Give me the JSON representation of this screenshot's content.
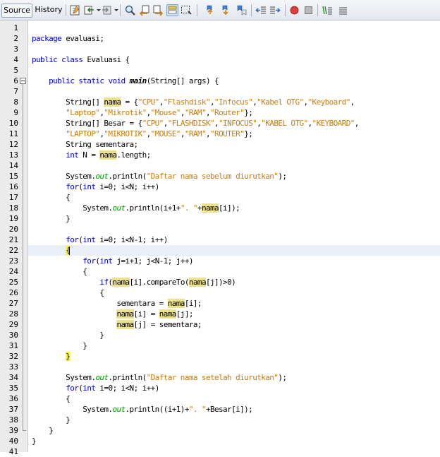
{
  "tabs": {
    "source": "Source",
    "history": "History"
  },
  "toolbar_icons": [
    "last-edit-icon",
    "back-icon",
    "forward-icon",
    "find-icon",
    "find-previous-icon",
    "find-next-icon",
    "toggle-highlight-icon",
    "find-selection-icon",
    "previous-bookmark-icon",
    "next-bookmark-icon",
    "toggle-bookmark-icon",
    "shift-left-icon",
    "shift-right-icon",
    "start-macro-icon",
    "stop-macro-icon",
    "comment-icon",
    "uncomment-icon"
  ],
  "colors": {
    "keyword": "#0000e6",
    "string": "#ce7b00",
    "field": "#009900",
    "highlight": "#ede18b",
    "brace_match": "#ffff00",
    "current_line": "#e9eff8"
  },
  "code": {
    "line_numbers": [
      "1",
      "2",
      "3",
      "4",
      "5",
      "6",
      "7",
      "8",
      "9",
      "10",
      "11",
      "12",
      "13",
      "14",
      "15",
      "16",
      "17",
      "18",
      "19",
      "20",
      "21",
      "22",
      "23",
      "24",
      "25",
      "26",
      "27",
      "28",
      "29",
      "30",
      "31",
      "32",
      "33",
      "34",
      "35",
      "36",
      "37",
      "38",
      "39",
      "40",
      "41"
    ],
    "lines": [
      [],
      [
        {
          "t": "package",
          "c": "kw"
        },
        {
          "t": " evaluasi;"
        }
      ],
      [],
      [
        {
          "t": "public",
          "c": "kw"
        },
        {
          "t": " "
        },
        {
          "t": "class",
          "c": "kw"
        },
        {
          "t": " Evaluasi {"
        }
      ],
      [],
      [
        {
          "t": "    "
        },
        {
          "t": "public",
          "c": "kw"
        },
        {
          "t": " "
        },
        {
          "t": "static",
          "c": "kw"
        },
        {
          "t": " "
        },
        {
          "t": "void",
          "c": "kw"
        },
        {
          "t": " "
        },
        {
          "t": "main",
          "c": "mth"
        },
        {
          "t": "(String[] args) {"
        }
      ],
      [],
      [
        {
          "t": "        String[] "
        },
        {
          "t": "nama",
          "c": "hl"
        },
        {
          "t": " = {"
        },
        {
          "t": "\"CPU\"",
          "c": "str"
        },
        {
          "t": ","
        },
        {
          "t": "\"Flashdisk\"",
          "c": "str"
        },
        {
          "t": ","
        },
        {
          "t": "\"Infocus\"",
          "c": "str"
        },
        {
          "t": ","
        },
        {
          "t": "\"Kabel OTG\"",
          "c": "str"
        },
        {
          "t": ","
        },
        {
          "t": "\"Keyboard\"",
          "c": "str"
        },
        {
          "t": ","
        }
      ],
      [
        {
          "t": "        "
        },
        {
          "t": "\"Laptop\"",
          "c": "str"
        },
        {
          "t": ","
        },
        {
          "t": "\"Mikrotik\"",
          "c": "str"
        },
        {
          "t": ","
        },
        {
          "t": "\"Mouse\"",
          "c": "str"
        },
        {
          "t": ","
        },
        {
          "t": "\"RAM\"",
          "c": "str"
        },
        {
          "t": ","
        },
        {
          "t": "\"Router\"",
          "c": "str"
        },
        {
          "t": "};"
        }
      ],
      [
        {
          "t": "        String[] Besar = {"
        },
        {
          "t": "\"CPU\"",
          "c": "str"
        },
        {
          "t": ","
        },
        {
          "t": "\"FLASHDISK\"",
          "c": "str"
        },
        {
          "t": ","
        },
        {
          "t": "\"INFOCUS\"",
          "c": "str"
        },
        {
          "t": ","
        },
        {
          "t": "\"KABEL OTG\"",
          "c": "str"
        },
        {
          "t": ","
        },
        {
          "t": "\"KEYBOARD\"",
          "c": "str"
        },
        {
          "t": ","
        }
      ],
      [
        {
          "t": "        "
        },
        {
          "t": "\"LAPTOP\"",
          "c": "str"
        },
        {
          "t": ","
        },
        {
          "t": "\"MIKROTIK\"",
          "c": "str"
        },
        {
          "t": ","
        },
        {
          "t": "\"MOUSE\"",
          "c": "str"
        },
        {
          "t": ","
        },
        {
          "t": "\"RAM\"",
          "c": "str"
        },
        {
          "t": ","
        },
        {
          "t": "\"ROUTER\"",
          "c": "str"
        },
        {
          "t": "};"
        }
      ],
      [
        {
          "t": "        String sementara;"
        }
      ],
      [
        {
          "t": "        "
        },
        {
          "t": "int",
          "c": "kw"
        },
        {
          "t": " N = "
        },
        {
          "t": "nama",
          "c": "hl"
        },
        {
          "t": ".length;"
        }
      ],
      [],
      [
        {
          "t": "        System."
        },
        {
          "t": "out",
          "c": "fld"
        },
        {
          "t": ".println("
        },
        {
          "t": "\"Daftar nama sebelum diurutkan\"",
          "c": "str"
        },
        {
          "t": ");"
        }
      ],
      [
        {
          "t": "        "
        },
        {
          "t": "for",
          "c": "kw"
        },
        {
          "t": "("
        },
        {
          "t": "int",
          "c": "kw"
        },
        {
          "t": " i=0; i<N; i++)"
        }
      ],
      [
        {
          "t": "        {"
        }
      ],
      [
        {
          "t": "            System."
        },
        {
          "t": "out",
          "c": "fld"
        },
        {
          "t": ".println(i+1+"
        },
        {
          "t": "\". \"",
          "c": "str"
        },
        {
          "t": "+"
        },
        {
          "t": "nama",
          "c": "hl"
        },
        {
          "t": "[i]);"
        }
      ],
      [
        {
          "t": "        }"
        }
      ],
      [],
      [
        {
          "t": "        "
        },
        {
          "t": "for",
          "c": "kw"
        },
        {
          "t": "("
        },
        {
          "t": "int",
          "c": "kw"
        },
        {
          "t": " i=0; i<N-1; i++)"
        }
      ],
      [
        {
          "t": "        "
        },
        {
          "t": "{",
          "c": "brace"
        },
        {
          "t": "",
          "c": "caret"
        }
      ],
      [
        {
          "t": "            "
        },
        {
          "t": "for",
          "c": "kw"
        },
        {
          "t": "("
        },
        {
          "t": "int",
          "c": "kw"
        },
        {
          "t": " j=i+1; j<N-1; j++)"
        }
      ],
      [
        {
          "t": "            {"
        }
      ],
      [
        {
          "t": "                "
        },
        {
          "t": "if",
          "c": "kw"
        },
        {
          "t": "("
        },
        {
          "t": "nama",
          "c": "hl"
        },
        {
          "t": "[i].compareTo("
        },
        {
          "t": "nama",
          "c": "hl"
        },
        {
          "t": "[j])>0)"
        }
      ],
      [
        {
          "t": "                {"
        }
      ],
      [
        {
          "t": "                    sementara = "
        },
        {
          "t": "nama",
          "c": "hl"
        },
        {
          "t": "[i];"
        }
      ],
      [
        {
          "t": "                    "
        },
        {
          "t": "nama",
          "c": "hl"
        },
        {
          "t": "[i] = "
        },
        {
          "t": "nama",
          "c": "hl"
        },
        {
          "t": "[j];"
        }
      ],
      [
        {
          "t": "                    "
        },
        {
          "t": "nama",
          "c": "hl"
        },
        {
          "t": "[j] = sementara;"
        }
      ],
      [
        {
          "t": "                }"
        }
      ],
      [
        {
          "t": "            }"
        }
      ],
      [
        {
          "t": "        "
        },
        {
          "t": "}",
          "c": "brace"
        }
      ],
      [],
      [
        {
          "t": "        System."
        },
        {
          "t": "out",
          "c": "fld"
        },
        {
          "t": ".println("
        },
        {
          "t": "\"Daftar nama setelah diurutkan\"",
          "c": "str"
        },
        {
          "t": ");"
        }
      ],
      [
        {
          "t": "        "
        },
        {
          "t": "for",
          "c": "kw"
        },
        {
          "t": "("
        },
        {
          "t": "int",
          "c": "kw"
        },
        {
          "t": " i=0; i<N; i++)"
        }
      ],
      [
        {
          "t": "        {"
        }
      ],
      [
        {
          "t": "            System."
        },
        {
          "t": "out",
          "c": "fld"
        },
        {
          "t": ".println((i+1)+"
        },
        {
          "t": "\". \"",
          "c": "str"
        },
        {
          "t": "+Besar[i]);"
        }
      ],
      [
        {
          "t": "        }"
        }
      ],
      [
        {
          "t": "    }"
        }
      ],
      [
        {
          "t": "}"
        }
      ],
      []
    ]
  }
}
